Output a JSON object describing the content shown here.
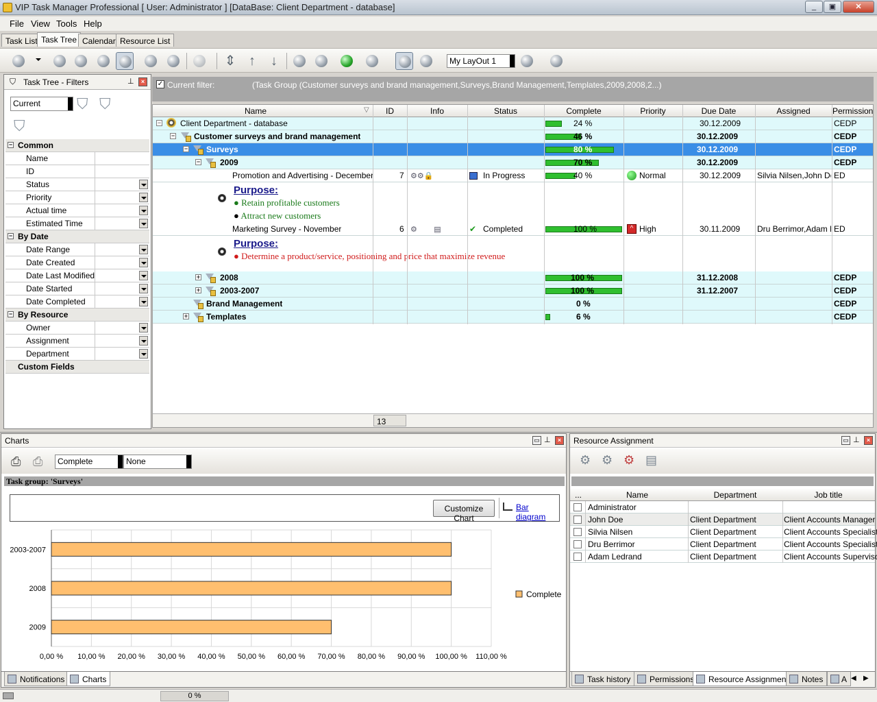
{
  "window": {
    "title": "VIP Task Manager Professional [ User: Administrator ] [DataBase: Client Department - database]"
  },
  "menu": [
    "File",
    "View",
    "Tools",
    "Help"
  ],
  "tabs": [
    "Task List",
    "Task Tree",
    "Calendar",
    "Resource List"
  ],
  "toolbar": {
    "layout_select": "My LayOut 1"
  },
  "filters_panel": {
    "title": "Task Tree - Filters",
    "current_select": "Current",
    "sections": [
      {
        "label": "Common",
        "items": [
          "Name",
          "ID",
          "Status",
          "Priority",
          "Actual time",
          "Estimated Time"
        ]
      },
      {
        "label": "By Date",
        "items": [
          "Date Range",
          "Date Created",
          "Date Last Modified",
          "Date Started",
          "Date Completed"
        ]
      },
      {
        "label": "By Resource",
        "items": [
          "Owner",
          "Assignment",
          "Department"
        ]
      },
      {
        "label": "Custom Fields",
        "items": []
      }
    ]
  },
  "filter_bar": {
    "label": "Current filter:",
    "value": "(Task Group  (Customer surveys and brand management,Surveys,Brand Management,Templates,2009,2008,2...)"
  },
  "grid": {
    "columns": [
      "Name",
      "ID",
      "Info",
      "Status",
      "Complete",
      "Priority",
      "Due Date",
      "Assigned",
      "Permission"
    ],
    "rows": {
      "r0": {
        "name": "Client Department - database",
        "complete": "24 %",
        "due": "30.12.2009",
        "perm": "CEDP",
        "pct": 24
      },
      "r1": {
        "name": "Customer surveys and brand management",
        "complete": "46 %",
        "due": "30.12.2009",
        "perm": "CEDP",
        "pct": 46
      },
      "r2": {
        "name": "Surveys",
        "complete": "80 %",
        "due": "30.12.2009",
        "perm": "CEDP",
        "pct": 80
      },
      "r3": {
        "name": "2009",
        "complete": "70 %",
        "due": "30.12.2009",
        "perm": "CEDP",
        "pct": 70
      },
      "r4": {
        "name": "Promotion and Advertising - December",
        "id": "7",
        "status": "In Progress",
        "complete": "40 %",
        "priority": "Normal",
        "due": "30.12.2009",
        "assigned": "Silvia Nilsen,John Doe",
        "perm": "ED",
        "pct": 40
      },
      "n1": {
        "title": "Purpose:",
        "bullets": [
          "Retain profitable customers",
          "Attract new customers"
        ]
      },
      "r5": {
        "name": "Marketing Survey - November",
        "id": "6",
        "status": "Completed",
        "complete": "100 %",
        "priority": "High",
        "due": "30.11.2009",
        "assigned": "Dru Berrimor,Adam Lec",
        "perm": "ED",
        "pct": 100
      },
      "n2": {
        "title": "Purpose:",
        "bullets": [
          "Determine a product/service, positioning and price that maximize revenue"
        ]
      },
      "r6": {
        "name": "2008",
        "complete": "100 %",
        "due": "31.12.2008",
        "perm": "CEDP",
        "pct": 100
      },
      "r7": {
        "name": "2003-2007",
        "complete": "100 %",
        "due": "31.12.2007",
        "perm": "CEDP",
        "pct": 100
      },
      "r8": {
        "name": "Brand Management",
        "complete": "0 %",
        "perm": "CEDP",
        "pct": 0
      },
      "r9": {
        "name": "Templates",
        "complete": "6 %",
        "perm": "CEDP",
        "pct": 6
      }
    },
    "footer_count": "13"
  },
  "charts_panel": {
    "title": "Charts",
    "select1": "Complete",
    "select2": "None",
    "group_label": "Task group: 'Surveys'",
    "customize_button": "Customize Chart",
    "diagram_link": "Bar diagram"
  },
  "chart_data": {
    "type": "bar",
    "orientation": "horizontal",
    "categories": [
      "2003-2007",
      "2008",
      "2009"
    ],
    "series": [
      {
        "name": "Complete",
        "values": [
          100,
          100,
          70
        ],
        "color": "#ffbf6f"
      }
    ],
    "xlim": [
      0,
      110
    ],
    "xticks": [
      "0,00 %",
      "10,00 %",
      "20,00 %",
      "30,00 %",
      "40,00 %",
      "50,00 %",
      "60,00 %",
      "70,00 %",
      "80,00 %",
      "90,00 %",
      "100,00 %",
      "110,00 %"
    ],
    "grid": true,
    "legend": "right"
  },
  "resource_panel": {
    "title": "Resource Assignment",
    "columns": [
      "...",
      "Name",
      "Department",
      "Job title"
    ],
    "rows": [
      {
        "name": "Administrator",
        "dept": "",
        "job": ""
      },
      {
        "name": "John Doe",
        "dept": "Client Department",
        "job": "Client Accounts Manager"
      },
      {
        "name": "Silvia Nilsen",
        "dept": "Client Department",
        "job": "Client Accounts Specialist"
      },
      {
        "name": "Dru Berrimor",
        "dept": "Client Department",
        "job": "Client Accounts Specialist"
      },
      {
        "name": "Adam Ledrand",
        "dept": "Client Department",
        "job": "Client Accounts Supervisor"
      }
    ]
  },
  "bottom_tabs_left": [
    "Notifications",
    "Charts"
  ],
  "bottom_tabs_right": [
    "Task history",
    "Permissions",
    "Resource Assignment",
    "Notes",
    "A"
  ],
  "statusbar": {
    "progress": "0 %"
  }
}
